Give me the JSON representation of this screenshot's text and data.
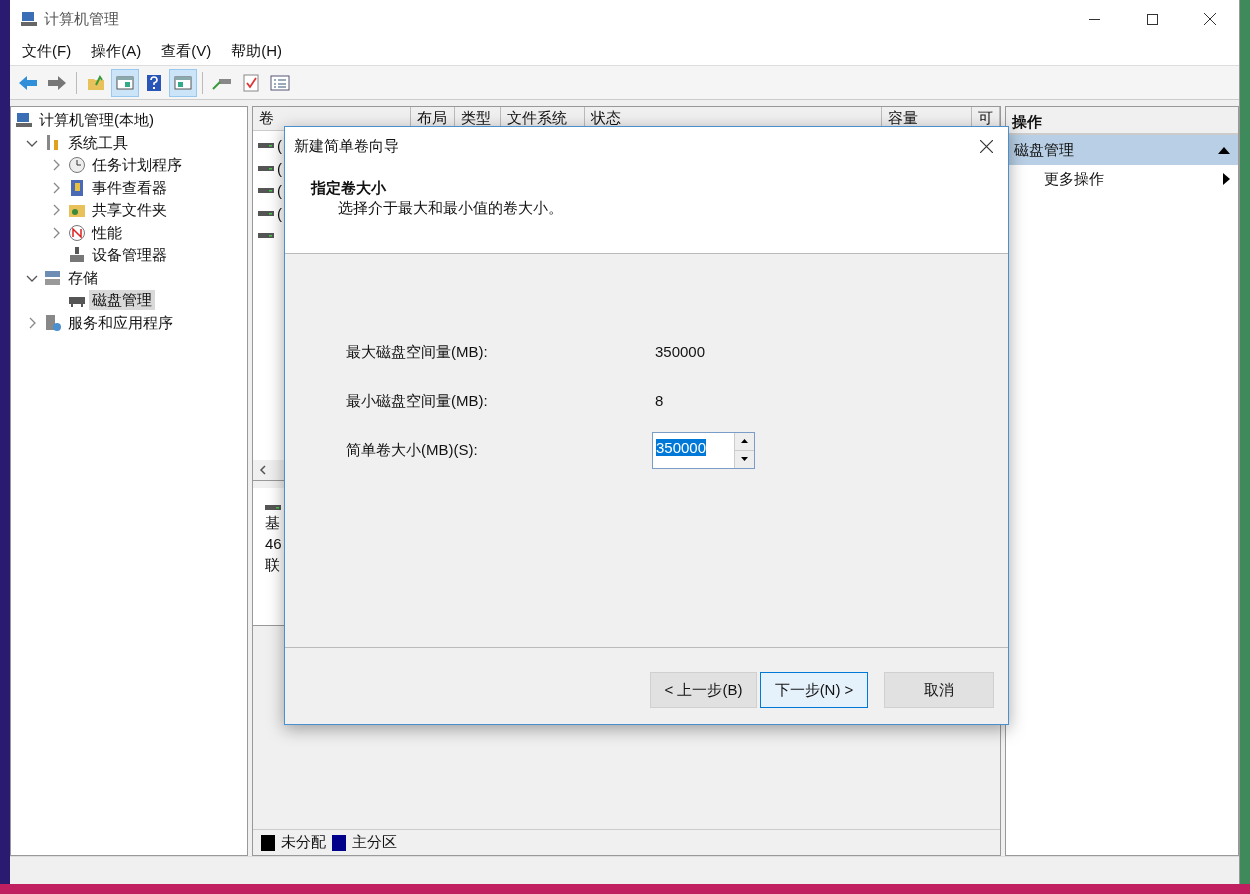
{
  "window": {
    "title": "计算机管理"
  },
  "menu": [
    "文件(F)",
    "操作(A)",
    "查看(V)",
    "帮助(H)"
  ],
  "toolbar": [
    {
      "kind": "back",
      "pressed": false
    },
    {
      "kind": "forward",
      "pressed": false
    },
    {
      "kind": "separator"
    },
    {
      "kind": "up",
      "pressed": false
    },
    {
      "kind": "tree",
      "pressed": true
    },
    {
      "kind": "help",
      "pressed": false
    },
    {
      "kind": "pane",
      "pressed": true
    },
    {
      "kind": "separator"
    },
    {
      "kind": "connect",
      "pressed": false
    },
    {
      "kind": "check",
      "pressed": false
    },
    {
      "kind": "list",
      "pressed": false
    }
  ],
  "tree": [
    {
      "label": "计算机管理(本地)",
      "kind": "computer",
      "selected": false,
      "children": [
        {
          "label": "系统工具",
          "kind": "tools",
          "expanded": true,
          "selected": false,
          "children": [
            {
              "label": "任务计划程序",
              "kind": "clock",
              "expanded": false,
              "selected": false
            },
            {
              "label": "事件查看器",
              "kind": "event",
              "expanded": false,
              "selected": false
            },
            {
              "label": "共享文件夹",
              "kind": "folder",
              "expanded": false,
              "selected": false
            },
            {
              "label": "性能",
              "kind": "gauge",
              "expanded": false,
              "selected": false
            },
            {
              "label": "设备管理器",
              "kind": "device",
              "selected": false
            }
          ]
        },
        {
          "label": "存储",
          "kind": "storage",
          "expanded": true,
          "selected": false,
          "children": [
            {
              "label": "磁盘管理",
              "kind": "disk",
              "selected": true
            }
          ]
        },
        {
          "label": "服务和应用程序",
          "kind": "services",
          "expanded": false,
          "selected": false
        }
      ]
    }
  ],
  "table": {
    "columns": [
      "卷",
      "布局",
      "类型",
      "文件系统",
      "状态",
      "容量",
      "可"
    ],
    "rows": [
      {
        "kind": "drive",
        "label": "("
      },
      {
        "kind": "drive",
        "label": "("
      },
      {
        "kind": "drive",
        "label": "("
      },
      {
        "kind": "drive",
        "label": "("
      },
      {
        "kind": "drive"
      }
    ]
  },
  "disk": {
    "lines": [
      "基",
      "46",
      "联"
    ]
  },
  "legend": [
    {
      "label": "未分配",
      "color": "#000000"
    },
    {
      "label": "主分区",
      "color": "#00008b"
    }
  ],
  "actions": {
    "title": "操作",
    "section": {
      "label": "磁盘管理",
      "expanded": true
    },
    "items": [
      {
        "label": "更多操作"
      }
    ]
  },
  "dialog": {
    "title": "新建简单卷向导",
    "heading": "指定卷大小",
    "subtitle": "选择介于最大和最小值的卷大小。",
    "fields": [
      {
        "kind": "text",
        "label": "最大磁盘空间量(MB):",
        "value": "350000"
      },
      {
        "kind": "text",
        "label": "最小磁盘空间量(MB):",
        "value": "8"
      },
      {
        "kind": "spin",
        "label": "简单卷大小(MB)(S):",
        "value": "350000",
        "selected": true
      }
    ],
    "buttons": [
      {
        "label": "< 上一步(B)",
        "default": false
      },
      {
        "label": "下一步(N) >",
        "default": true
      },
      {
        "label": "取消",
        "default": false
      }
    ]
  }
}
